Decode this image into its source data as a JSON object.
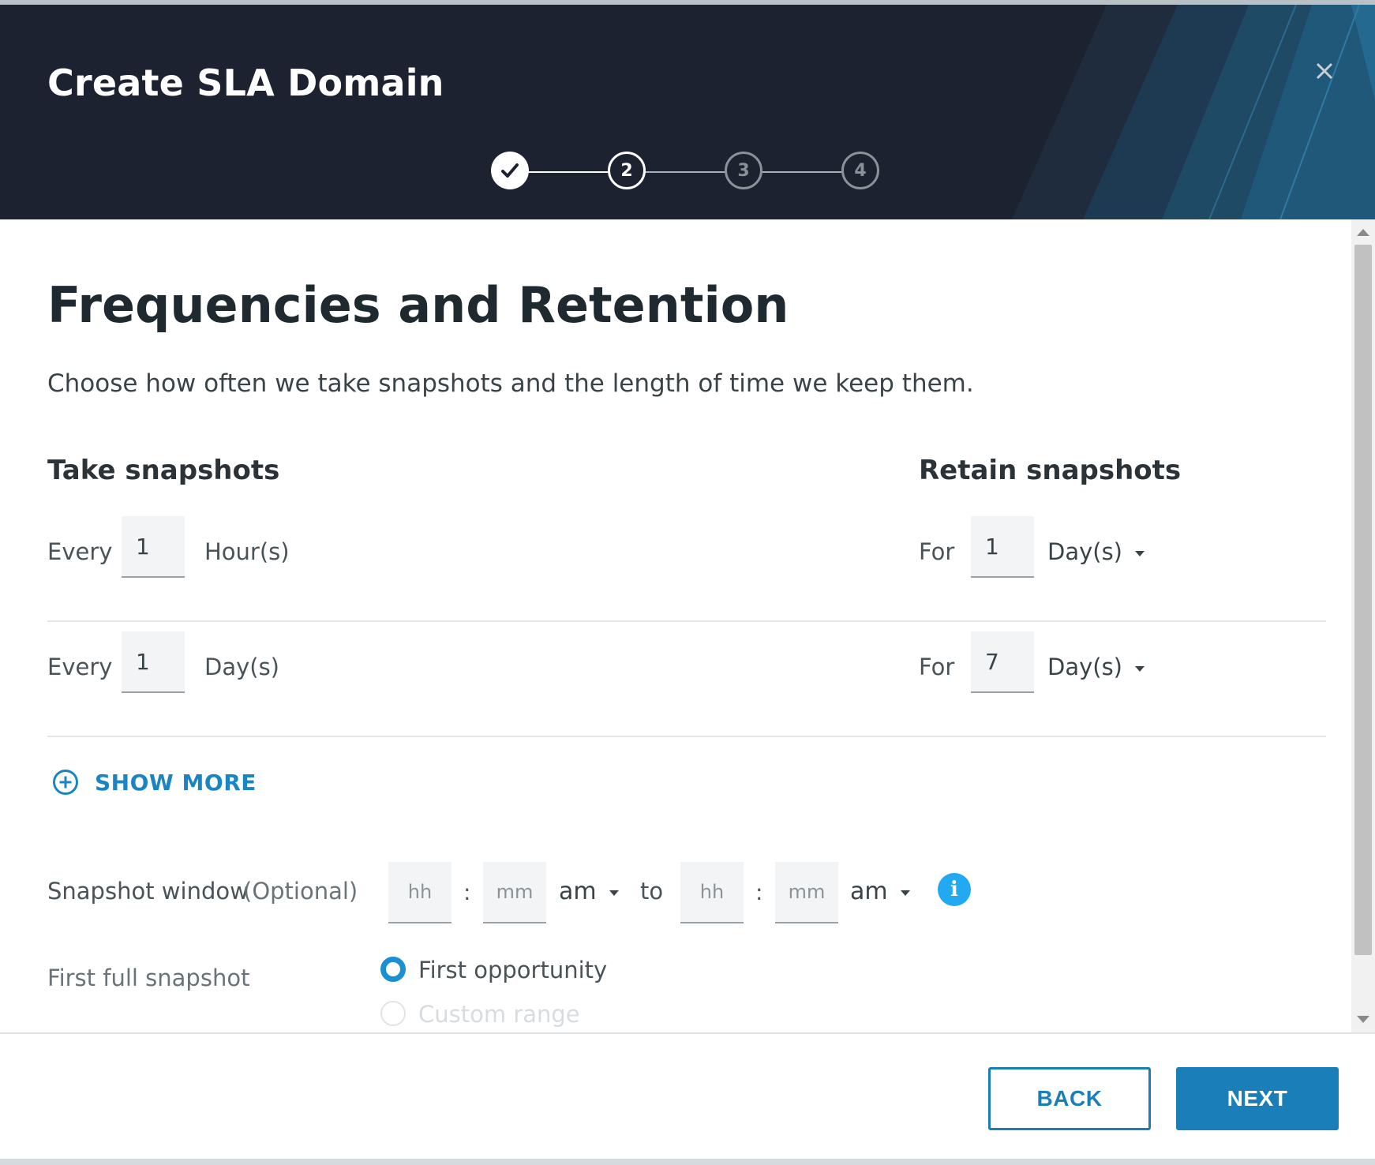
{
  "header": {
    "title": "Create SLA Domain",
    "steps": [
      {
        "label": "1",
        "state": "done"
      },
      {
        "label": "2",
        "state": "active"
      },
      {
        "label": "3",
        "state": "pending"
      },
      {
        "label": "4",
        "state": "pending"
      }
    ]
  },
  "main": {
    "title": "Frequencies and Retention",
    "description": "Choose how often we take snapshots and the length of time we keep them.",
    "take_heading": "Take snapshots",
    "retain_heading": "Retain snapshots",
    "rows": [
      {
        "every_label": "Every",
        "frequency": "1",
        "frequency_unit": "Hour(s)",
        "for_label": "For",
        "retention": "1",
        "retention_unit": "Day(s)"
      },
      {
        "every_label": "Every",
        "frequency": "1",
        "frequency_unit": "Day(s)",
        "for_label": "For",
        "retention": "7",
        "retention_unit": "Day(s)"
      }
    ],
    "show_more": "SHOW MORE",
    "snapshot_window": {
      "label": "Snapshot window",
      "optional": "(Optional)",
      "start_hh_placeholder": "hh",
      "start_mm_placeholder": "mm",
      "start_ampm": "am",
      "to": "to",
      "end_hh_placeholder": "hh",
      "end_mm_placeholder": "mm",
      "end_ampm": "am",
      "separator": ":"
    },
    "first_full_snapshot": {
      "label": "First full snapshot",
      "options": [
        {
          "label": "First opportunity",
          "selected": true
        },
        {
          "label": "Custom range",
          "selected": false
        }
      ]
    }
  },
  "footer": {
    "back": "BACK",
    "next": "NEXT"
  },
  "colors": {
    "header_bg": "#1c2230",
    "accent": "#1a7fb8",
    "info": "#22a9f0"
  },
  "icons": {
    "close": "close-icon",
    "check": "check-icon",
    "plus": "plus-circle-icon",
    "info": "info-icon"
  }
}
